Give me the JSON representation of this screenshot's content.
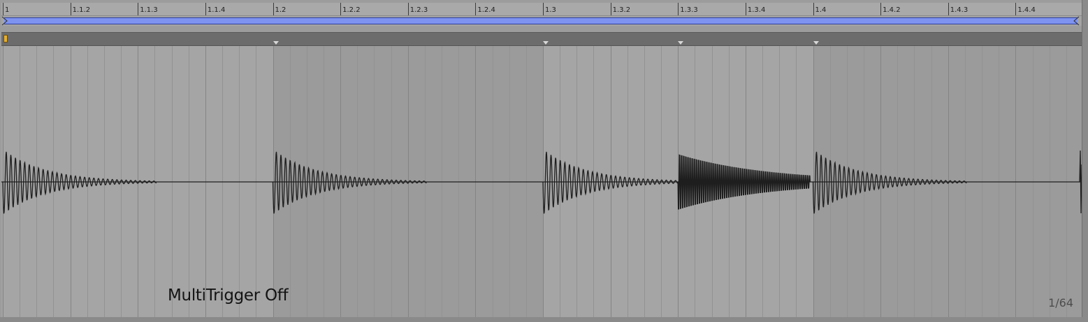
{
  "ruler": {
    "labels": [
      "1",
      "1.1.2",
      "1.1.3",
      "1.1.4",
      "1.2",
      "1.2.2",
      "1.2.3",
      "1.2.4",
      "1.3",
      "1.3.2",
      "1.3.3",
      "1.3.4",
      "1.4",
      "1.4.2",
      "1.4.3",
      "1.4.4"
    ]
  },
  "waveform": {
    "hits_in_beats": [
      0,
      1,
      2,
      2.5,
      3
    ],
    "caption": "MultiTrigger Off"
  },
  "zoom": {
    "grid_label": "1/64"
  },
  "colors": {
    "loop_brace": "#7e93f0",
    "start_marker": "#e2b03a",
    "waveform": "#1e1e1e"
  }
}
